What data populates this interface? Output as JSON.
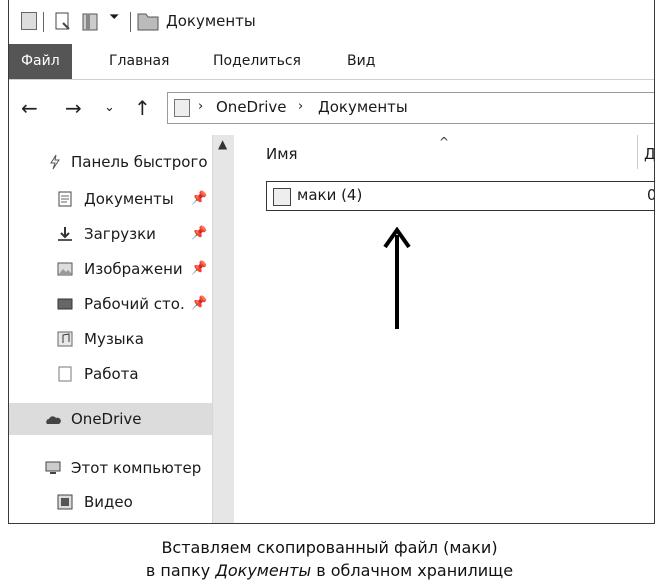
{
  "window": {
    "title": "Документы"
  },
  "ribbon": {
    "tabs": [
      {
        "label": "Файл",
        "active": true
      },
      {
        "label": "Главная"
      },
      {
        "label": "Поделиться"
      },
      {
        "label": "Вид"
      }
    ]
  },
  "address": {
    "crumbs": [
      "OneDrive",
      "Документы"
    ]
  },
  "sidebar": {
    "items": [
      {
        "label": "Панель быстрого",
        "icon": "quick-access-icon"
      },
      {
        "label": "Документы",
        "icon": "documents-icon",
        "pinned": true
      },
      {
        "label": "Загрузки",
        "icon": "downloads-icon",
        "pinned": true
      },
      {
        "label": "Изображени",
        "icon": "pictures-icon",
        "pinned": true
      },
      {
        "label": "Рабочий сто.",
        "icon": "desktop-icon",
        "pinned": true
      },
      {
        "label": "Музыка",
        "icon": "music-icon"
      },
      {
        "label": "Работа",
        "icon": "folder-icon"
      },
      {
        "label": "OneDrive",
        "icon": "onedrive-icon",
        "selected": true
      },
      {
        "label": "Этот компьютер",
        "icon": "this-pc-icon"
      },
      {
        "label": "Видео",
        "icon": "video-icon"
      }
    ]
  },
  "content": {
    "column_name": "Имя",
    "column_date_partial": "Д",
    "file": {
      "name": "маки (4)",
      "date_partial": "0"
    }
  },
  "caption": {
    "line1": "Вставляем скопированный файл (маки)",
    "line2_before": "в папку ",
    "line2_em": "Документы",
    "line2_after": " в облачном хранилище"
  }
}
